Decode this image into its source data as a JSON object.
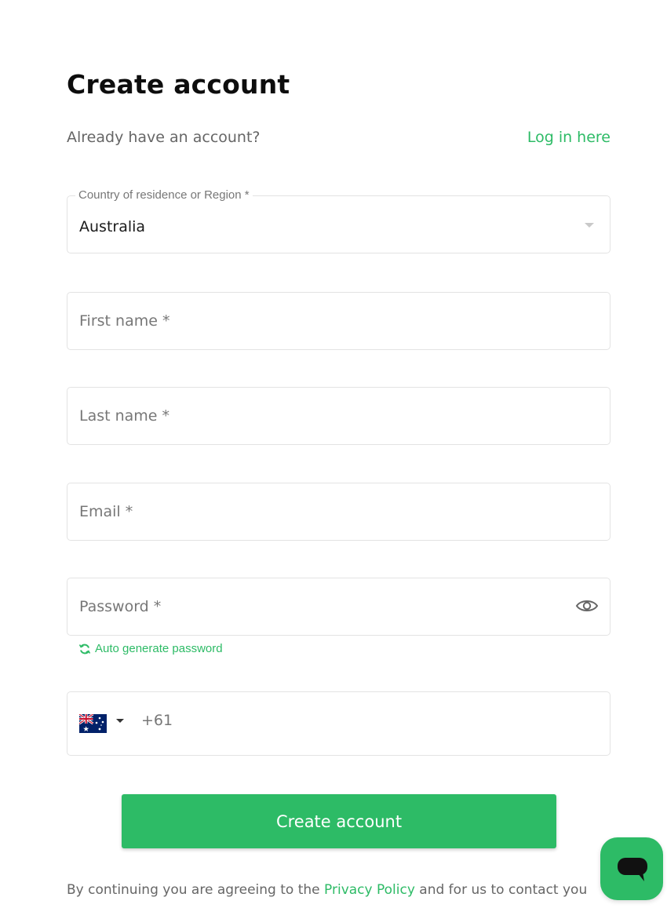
{
  "header": {
    "title": "Create account"
  },
  "login": {
    "prompt": "Already have an account?",
    "link": "Log in here"
  },
  "form": {
    "country": {
      "label": "Country of residence or Region *",
      "value": "Australia"
    },
    "first_name": {
      "placeholder": "First name *"
    },
    "last_name": {
      "placeholder": "Last name *"
    },
    "email": {
      "placeholder": "Email *"
    },
    "password": {
      "placeholder": "Password *",
      "auto_generate": "Auto generate password"
    },
    "phone": {
      "flag_icon": "australia-flag-icon",
      "dial_code": "+61"
    },
    "submit_label": "Create account"
  },
  "legal": {
    "prefix": "By continuing you are agreeing to the",
    "policy_link": "Privacy Policy",
    "suffix": "and for us to contact you"
  },
  "chat": {
    "icon": "chat-bubble-icon"
  },
  "colors": {
    "accent": "#2dbb66",
    "border": "#e3e3e3",
    "muted_text": "#777777"
  }
}
